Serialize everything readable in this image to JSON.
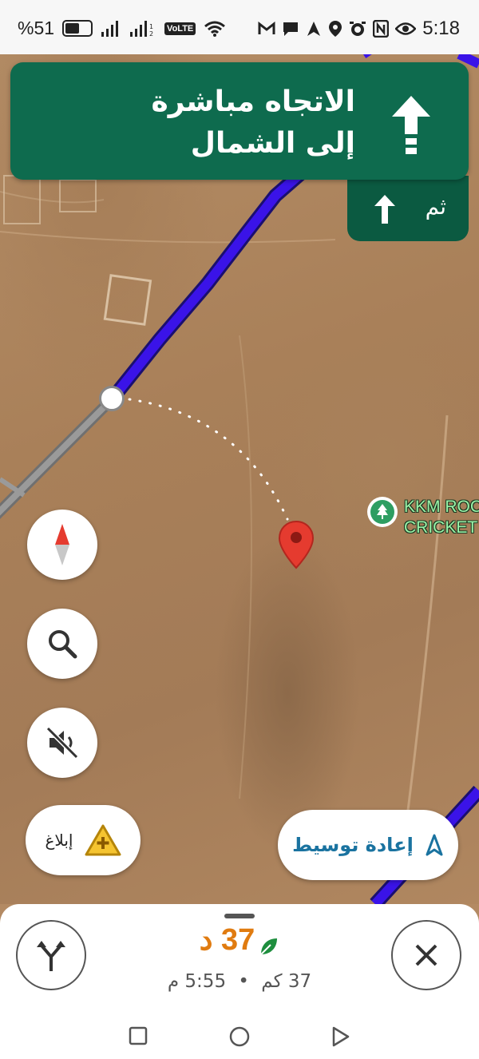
{
  "status_bar": {
    "battery": "%51",
    "time": "5:18",
    "volte": "VoLTE",
    "icons": [
      "battery-icon",
      "signal-icon",
      "signal-icon-2",
      "volte-icon",
      "wifi-icon",
      "gmail-icon",
      "chat-icon",
      "navigation-icon",
      "location-icon",
      "alarm-icon",
      "nfc-icon",
      "eye-icon"
    ]
  },
  "navigation": {
    "instruction": "الاتجاه مباشرة\nإلى الشمال",
    "instruction_line1": "الاتجاه مباشرة",
    "instruction_line2": "إلى الشمال",
    "then_label": "ثم",
    "banner_color": "#0e6b4e"
  },
  "map": {
    "place_label_line1": "KKM ROC",
    "place_label_line2": "CRICKET",
    "route_color": "#3a13e8"
  },
  "buttons": {
    "report_label": "إبلاغ",
    "recenter_label": "إعادة توسيط"
  },
  "trip": {
    "eta_time": "37 د",
    "distance": "37 كم",
    "separator": "•",
    "arrival": "5:55 م",
    "eta_color": "#e07b10"
  }
}
